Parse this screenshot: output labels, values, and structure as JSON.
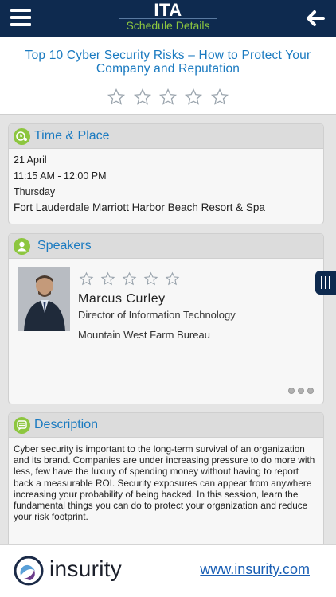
{
  "app": {
    "title": "ITA",
    "subtitle": "Schedule Details"
  },
  "session": {
    "title": "Top 10 Cyber Security Risks – How to Protect Your Company and Reputation",
    "rating": 0,
    "rating_max": 5
  },
  "time_place": {
    "heading": "Time & Place",
    "date": "21 April",
    "time": "11:15 AM - 12:00 PM",
    "day": "Thursday",
    "venue": "Fort Lauderdale Marriott Harbor Beach Resort & Spa"
  },
  "speakers": {
    "heading": "Speakers",
    "items": [
      {
        "name": "Marcus Curley",
        "role": "Director of Information Technology",
        "organization": "Mountain West Farm Bureau",
        "rating": 0,
        "rating_max": 5
      }
    ],
    "pages": 3
  },
  "description": {
    "heading": "Description",
    "text": "Cyber security is important to the long-term survival of an organization and its brand. Companies are under increasing pressure to do more with less, few have the luxury of spending money without having to report back a measurable ROI. Security exposures can appear from anywhere increasing your probability of being hacked. In this session, learn the fundamental things you can do to protect your organization and reduce your risk footprint."
  },
  "footer": {
    "brand": "insurity",
    "link": "www.insurity.com"
  },
  "colors": {
    "nav": "#0e2a4f",
    "accent_green": "#8dc63f",
    "accent_blue": "#1a7ac0",
    "link": "#1a5fb4"
  },
  "icons": {
    "menu": "hamburger-icon",
    "back": "arrow-left-icon",
    "rating": "star-outline-icon",
    "time_place": "clock-pin-icon",
    "speakers": "person-icon",
    "description": "chat-bubble-icon",
    "side_tab": "panel-toggle-icon"
  }
}
